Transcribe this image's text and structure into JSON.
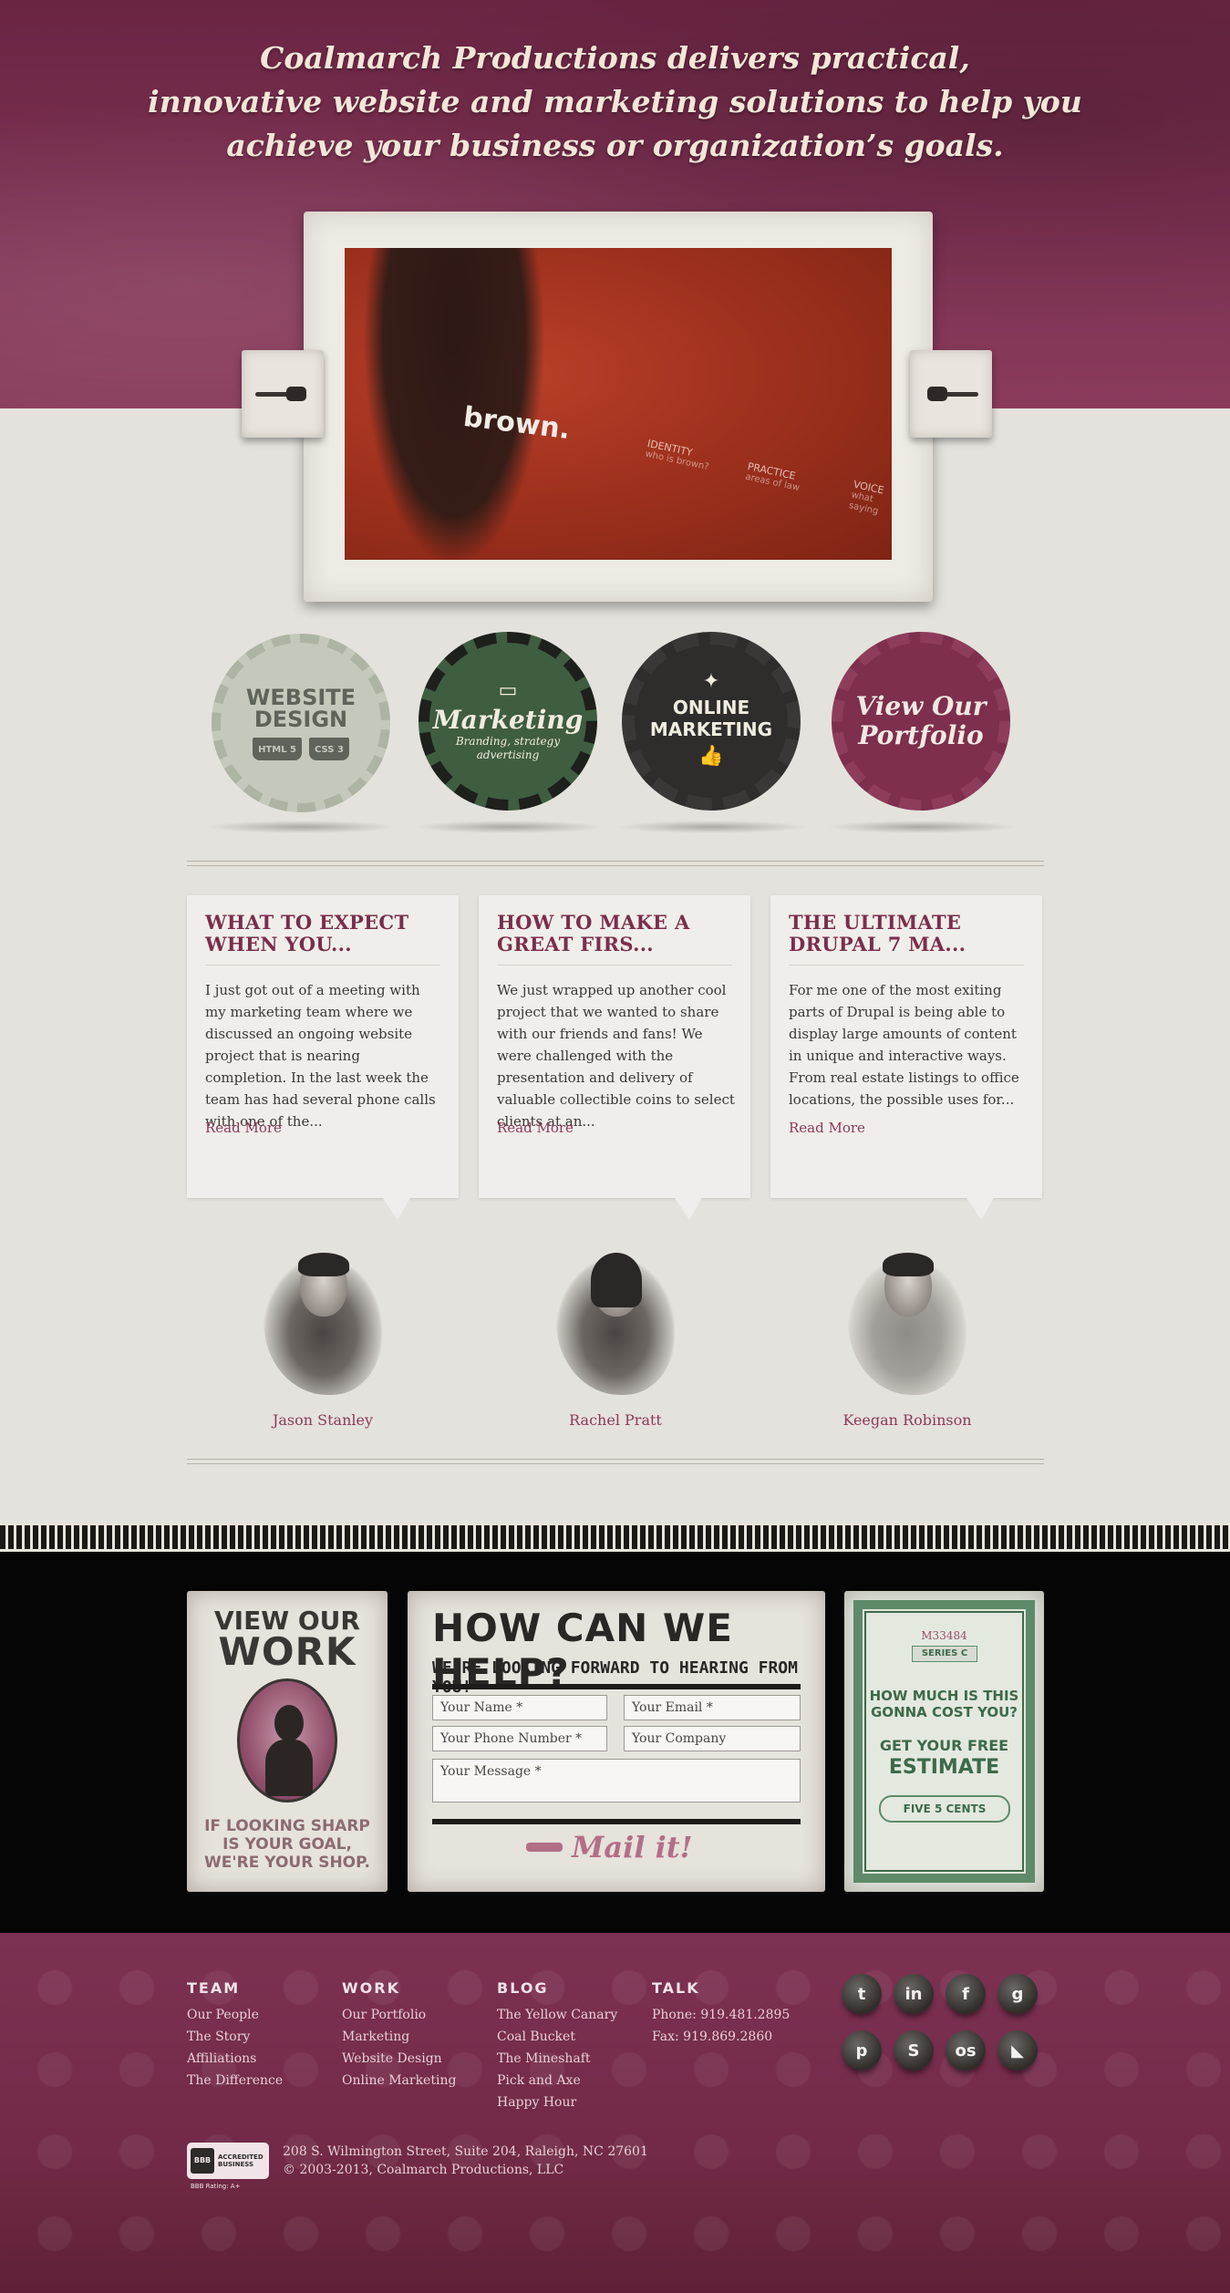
{
  "hero": {
    "tagline_lines": [
      "Coalmarch Productions delivers practical,",
      "innovative website and marketing solutions to help you",
      "achieve your business or organization’s goals."
    ]
  },
  "slider": {
    "brand": "brown.",
    "tags": [
      {
        "label": "IDENTITY",
        "sub": "who is brown?"
      },
      {
        "label": "PRACTICE",
        "sub": "areas of law"
      },
      {
        "label": "VOICE",
        "sub": "what saying"
      }
    ],
    "prev_icon": "pointing-hand-left-icon",
    "next_icon": "pointing-hand-right-icon"
  },
  "services": {
    "website": {
      "line1": "WEBSITE",
      "line2": "DESIGN",
      "badges": [
        "HTML 5",
        "CSS 3"
      ]
    },
    "marketing": {
      "title": "Marketing",
      "sub": "Branding, strategy advertising",
      "icon": "presentation-board-icon"
    },
    "online": {
      "line1": "ONLINE",
      "line2": "MARKETING",
      "icon": "bird-icon"
    },
    "portfolio": {
      "line1": "View Our",
      "line2": "Portfolio"
    }
  },
  "blog": {
    "read_more": "Read More",
    "posts": [
      {
        "title": "WHAT TO EXPECT WHEN YOU...",
        "excerpt": "I just got out of a meeting with my marketing team where we discussed an ongoing website project that is nearing completion. In the last week the team has had several phone calls with one of the..."
      },
      {
        "title": "HOW TO MAKE A GREAT FIRS...",
        "excerpt": "We just wrapped up another cool project that we wanted to share with our friends and fans! We were challenged with the presentation and delivery of valuable collectible coins to select clients at an..."
      },
      {
        "title": "THE ULTIMATE DRUPAL 7 MA...",
        "excerpt": "For me one of the most exiting parts of Drupal is being able to display large amounts of content in unique and interactive ways. From real estate listings to office locations, the possible uses for..."
      }
    ]
  },
  "team": [
    "Jason Stanley",
    "Rachel Pratt",
    "Keegan Robinson"
  ],
  "contact": {
    "work": {
      "line1": "VIEW OUR",
      "line2": "WORK",
      "tag": [
        "IF LOOKING SHARP",
        "IS YOUR GOAL,",
        "WE'RE YOUR SHOP."
      ]
    },
    "help": {
      "title": "HOW CAN WE HELP?",
      "subtitle": "WE'RE LOOKING FORWARD TO HEARING FROM YOU!",
      "name": "Your Name *",
      "email": "Your Email *",
      "phone": "Your Phone Number *",
      "company": "Your Company",
      "message": "Your Message *",
      "submit": "Mail it!"
    },
    "estimate": {
      "serial": "M33484",
      "series": "SERIES C",
      "question": [
        "HOW MUCH IS THIS",
        "GONNA COST YOU?"
      ],
      "cta1": "GET YOUR FREE",
      "cta2": "ESTIMATE",
      "cents": "FIVE 5 CENTS"
    }
  },
  "footer": {
    "cols": [
      {
        "heading": "TEAM",
        "links": [
          "Our People",
          "The Story",
          "Affiliations",
          "The Difference"
        ]
      },
      {
        "heading": "WORK",
        "links": [
          "Our Portfolio",
          "Marketing",
          "Website Design",
          "Online Marketing"
        ]
      },
      {
        "heading": "BLOG",
        "links": [
          "The Yellow Canary",
          "Coal Bucket",
          "The Mineshaft",
          "Pick and Axe",
          "Happy Hour"
        ]
      },
      {
        "heading": "TALK",
        "links": [
          "Phone: 919.481.2895",
          "Fax: 919.869.2860"
        ]
      }
    ],
    "social": [
      {
        "name": "twitter-icon",
        "glyph": "t"
      },
      {
        "name": "linkedin-icon",
        "glyph": "in"
      },
      {
        "name": "facebook-icon",
        "glyph": "f"
      },
      {
        "name": "google-icon",
        "glyph": "g"
      },
      {
        "name": "pinterest-icon",
        "glyph": "p"
      },
      {
        "name": "skype-icon",
        "glyph": "S"
      },
      {
        "name": "lastfm-icon",
        "glyph": "os"
      },
      {
        "name": "rss-icon",
        "glyph": "◣"
      }
    ],
    "bbb": {
      "a": "BBB",
      "b": "ACCREDITED",
      "c": "BUSINESS",
      "rating": "BBB Rating: A+"
    },
    "address": "208 S. Wilmington Street, Suite 204, Raleigh, NC 27601",
    "copyright": "© 2003-2013, Coalmarch Productions, LLC"
  },
  "colors": {
    "accent": "#7d3152",
    "link": "#8b3a5a",
    "green": "#3f5d40"
  }
}
